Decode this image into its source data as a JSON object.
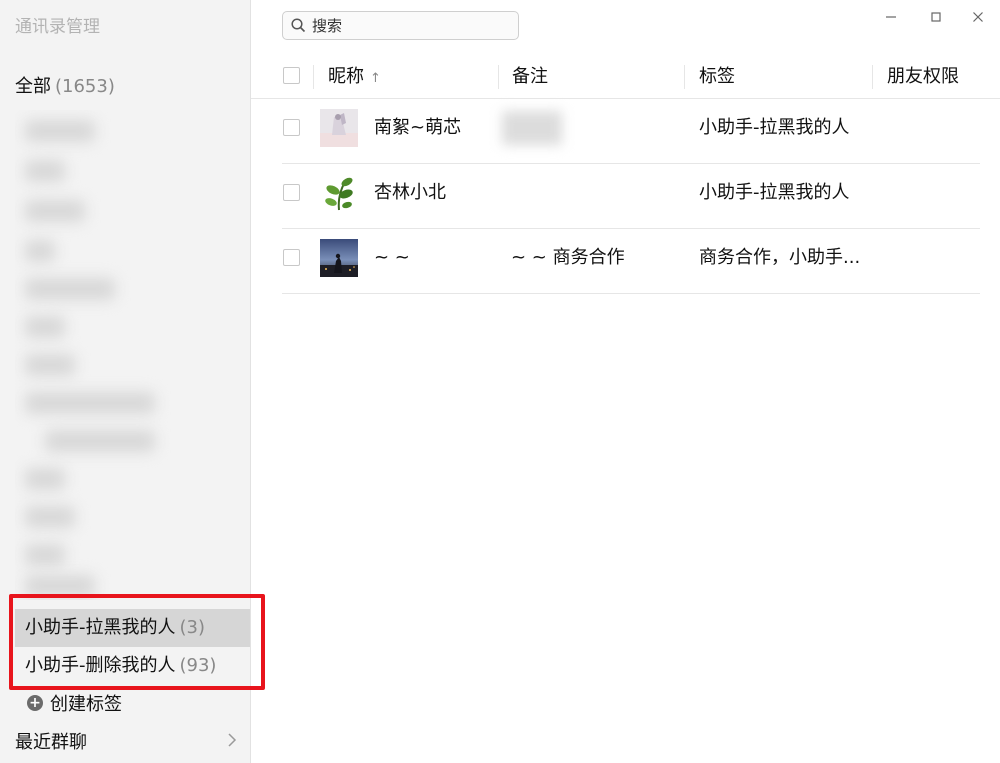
{
  "sidebar": {
    "title": "通讯录管理",
    "all": {
      "label": "全部",
      "count": "(1653)"
    },
    "tags": [
      {
        "label": "小助手-拉黑我的人",
        "count": "(3)"
      },
      {
        "label": "小助手-删除我的人",
        "count": "(93)"
      }
    ],
    "create_tag": "创建标签",
    "recent_groups": "最近群聊"
  },
  "search": {
    "placeholder": "搜索"
  },
  "table": {
    "headers": {
      "nickname": "昵称",
      "remark": "备注",
      "tags": "标签",
      "permission": "朋友权限"
    },
    "rows": [
      {
        "nickname": "南絮~萌芯",
        "remark": "",
        "tags": "小助手-拉黑我的人"
      },
      {
        "nickname": "杏林小北",
        "remark": "",
        "tags": "小助手-拉黑我的人"
      },
      {
        "nickname": "~ ~",
        "remark": "~ ~ 商务合作",
        "tags": "商务合作，小助手..."
      }
    ]
  },
  "colors": {
    "highlight": "#e8141c",
    "selected_bg": "#d6d6d6",
    "sidebar_bg": "#f3f3f3"
  }
}
